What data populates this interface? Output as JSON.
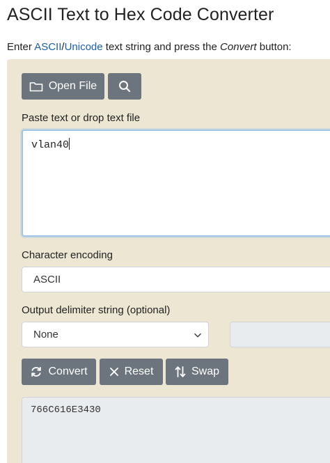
{
  "header": {
    "title": "ASCII Text to Hex Code Converter"
  },
  "intro": {
    "prefix": "Enter ",
    "link_ascii": "ASCII",
    "slash": "/",
    "link_unicode": "Unicode",
    "middle": " text string and press the ",
    "emphasis": "Convert",
    "suffix": " button:"
  },
  "toolbar": {
    "open_file_label": "Open File",
    "open_file_icon": "folder-icon",
    "search_icon": "search-icon"
  },
  "input": {
    "label": "Paste text or drop text file",
    "value": "vlan40"
  },
  "encoding": {
    "label": "Character encoding",
    "selected": "ASCII"
  },
  "delimiter": {
    "label": "Output delimiter string (optional)",
    "selected": "None"
  },
  "actions": {
    "convert_label": "Convert",
    "convert_icon": "refresh-icon",
    "reset_label": "Reset",
    "reset_icon": "close-icon",
    "swap_label": "Swap",
    "swap_icon": "swap-arrows-icon"
  },
  "output": {
    "value": "766C616E3430"
  },
  "colors": {
    "panel_bg": "#ede6d3",
    "button_bg": "#6c757d",
    "link": "#1a5fa8",
    "focus_border": "#9ec5e8",
    "readonly_bg": "#e9ecef"
  }
}
